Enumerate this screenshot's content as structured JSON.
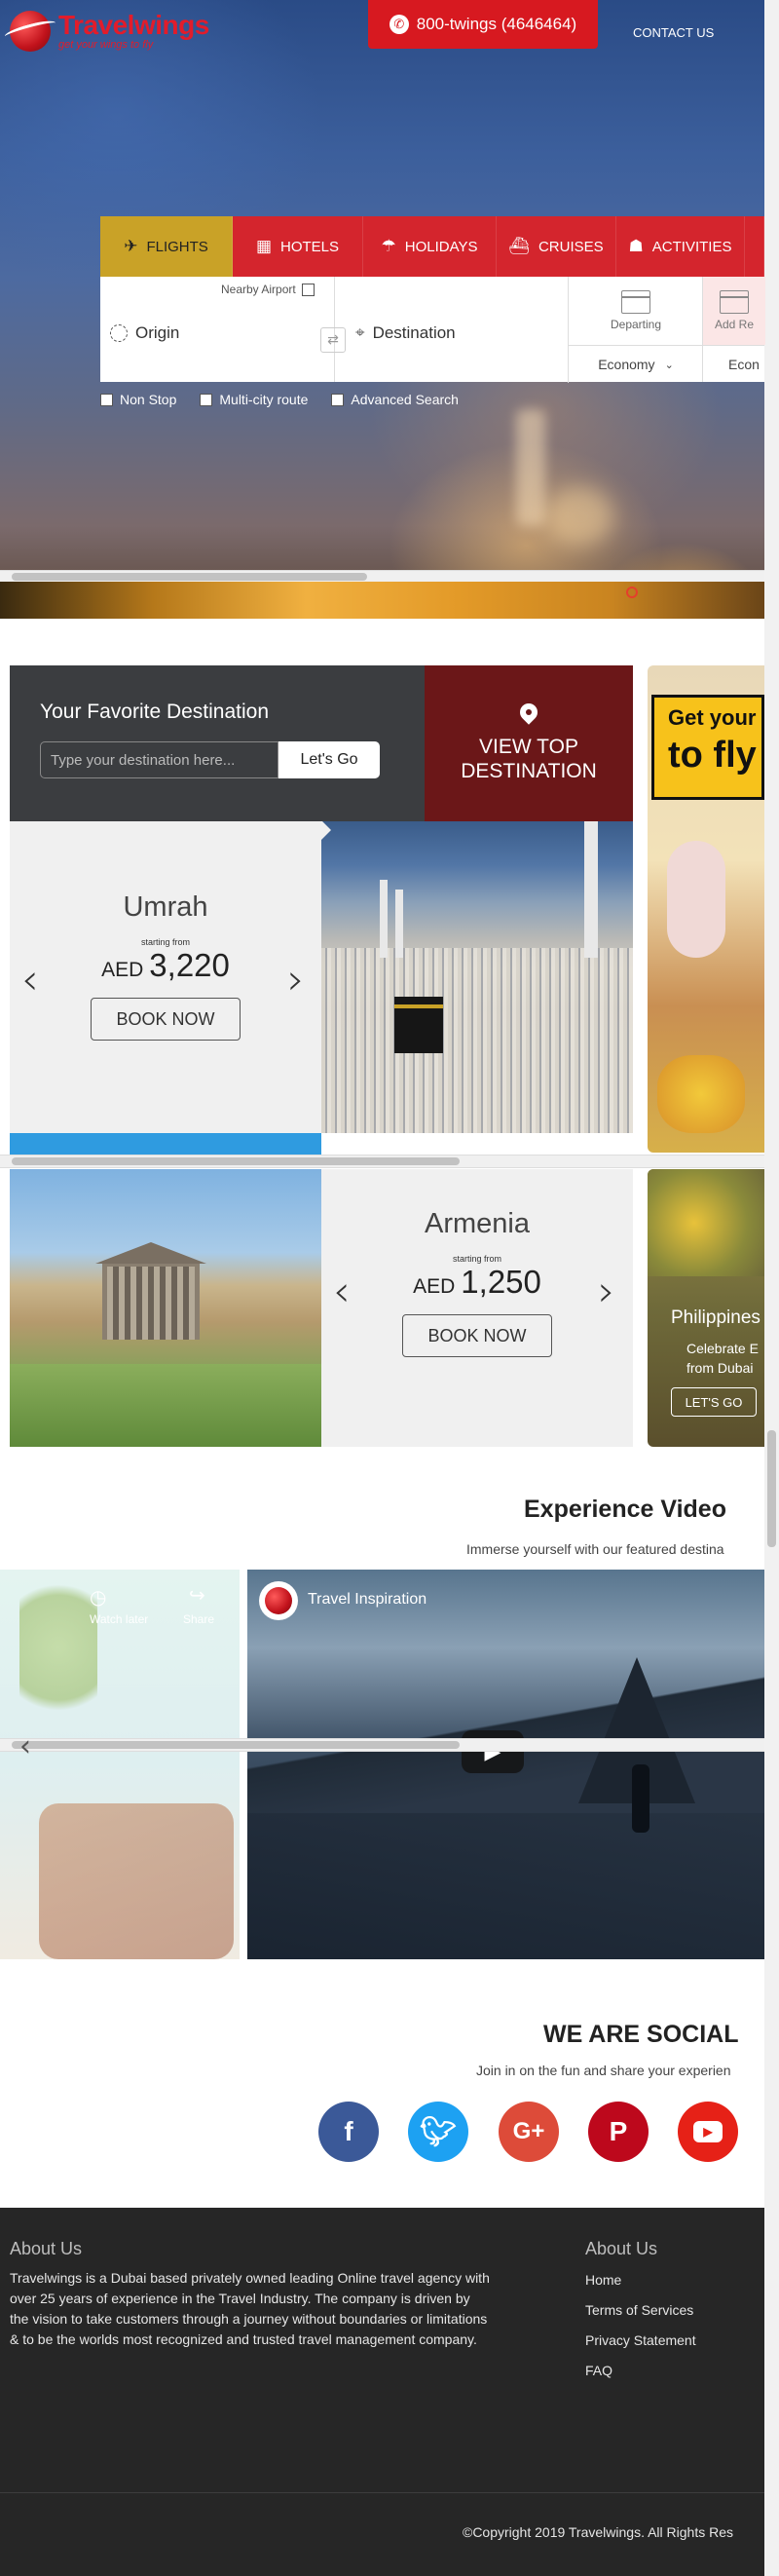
{
  "header": {
    "brand_name": "Travelwings",
    "tagline": "get your wings to fly",
    "phone_label": "800-twings (4646464)",
    "contact_label": "CONTACT US"
  },
  "search": {
    "tabs": [
      {
        "label": "FLIGHTS",
        "icon": "plane-icon",
        "active": true
      },
      {
        "label": "HOTELS",
        "icon": "hotel-icon",
        "active": false
      },
      {
        "label": "HOLIDAYS",
        "icon": "umbrella-icon",
        "active": false
      },
      {
        "label": "CRUISES",
        "icon": "ship-icon",
        "active": false
      },
      {
        "label": "ACTIVITIES",
        "icon": "activities-icon",
        "active": false
      }
    ],
    "nearby_airport": "Nearby Airport",
    "origin_placeholder": "Origin",
    "destination_placeholder": "Destination",
    "departing_label": "Departing",
    "add_return_label": "Add Re",
    "cabin_class": "Economy",
    "cabin_class_2": "Econ",
    "options": [
      "Non Stop",
      "Multi-city route",
      "Advanced Search"
    ]
  },
  "favorites": {
    "title": "Your Favorite Destination",
    "input_placeholder": "Type your destination here...",
    "go_label": "Let's Go",
    "view_top_line1": "VIEW TOP",
    "view_top_line2": "DESTINATION",
    "promo_line1": "Get your",
    "promo_line2": "to fly",
    "cards": [
      {
        "name": "Umrah",
        "starting_from": "starting from",
        "currency": "AED",
        "price": "3,220",
        "book_label": "BOOK NOW"
      },
      {
        "name": "Armenia",
        "starting_from": "starting from",
        "currency": "AED",
        "price": "1,250",
        "book_label": "BOOK NOW"
      }
    ],
    "side_card": {
      "name": "Philippines",
      "text_line1": "Celebrate E",
      "text_line2": "from Dubai",
      "cta": "LET'S GO"
    }
  },
  "video": {
    "title": "Experience Video",
    "subtitle": "Immerse yourself with our featured destina",
    "main_video_title": "Travel Inspiration",
    "watch_later": "Watch later",
    "share": "Share"
  },
  "social": {
    "title": "WE ARE SOCIAL",
    "subtitle": "Join in on the fun and share your experien",
    "networks": [
      {
        "name": "facebook-icon",
        "glyph": "f",
        "color": "#3b5998"
      },
      {
        "name": "twitter-icon",
        "glyph": "t",
        "color": "#1da1f2"
      },
      {
        "name": "google-plus-icon",
        "glyph": "G+",
        "color": "#dd4b39"
      },
      {
        "name": "pinterest-icon",
        "glyph": "P",
        "color": "#bd081c"
      },
      {
        "name": "youtube-icon",
        "glyph": "▶",
        "color": "#e62117"
      }
    ]
  },
  "footer": {
    "about_title": "About Us",
    "about_text": "Travelwings is a Dubai based privately owned leading Online travel agency with over 25 years of experience in the Travel Industry. The company is driven by the vision to take customers through a journey without boundaries or limitations & to be the worlds most recognized and trusted travel management company.",
    "links_title": "About Us",
    "links": [
      "Home",
      "Terms of Services",
      "Privacy Statement",
      "FAQ"
    ],
    "copyright": "©Copyright 2019 Travelwings. All Rights Res"
  },
  "colors": {
    "brand_red": "#d71920",
    "active_tab": "#c9a227",
    "dark_panel": "#3b3d40",
    "maroon": "#6b1718",
    "footer_bg": "#262626"
  }
}
